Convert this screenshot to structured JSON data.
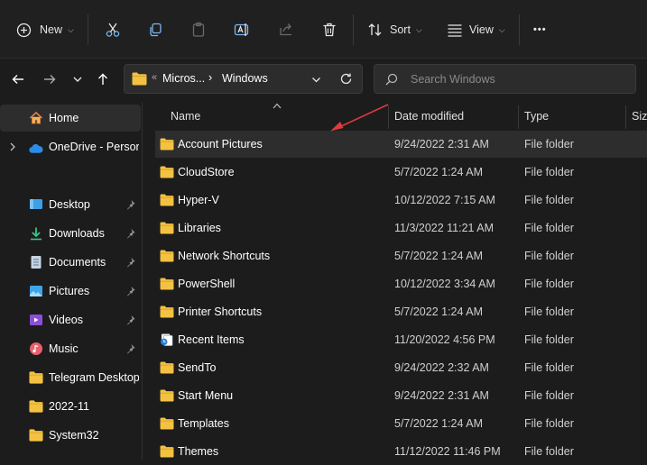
{
  "toolbar": {
    "new_label": "New",
    "sort_label": "Sort",
    "view_label": "View",
    "more_label": "•••"
  },
  "address": {
    "overflow": "«",
    "crumb1": "Micros...",
    "crumb_sep": "›",
    "crumb2": "Windows"
  },
  "search": {
    "placeholder": "Search Windows"
  },
  "nav": {
    "home": "Home",
    "onedrive": "OneDrive - Persona",
    "items": [
      {
        "label": "Desktop",
        "icon": "desktop-icon",
        "pinned": true
      },
      {
        "label": "Downloads",
        "icon": "downloads-icon",
        "pinned": true
      },
      {
        "label": "Documents",
        "icon": "documents-icon",
        "pinned": true
      },
      {
        "label": "Pictures",
        "icon": "pictures-icon",
        "pinned": true
      },
      {
        "label": "Videos",
        "icon": "videos-icon",
        "pinned": true
      },
      {
        "label": "Music",
        "icon": "music-icon",
        "pinned": true
      },
      {
        "label": "Telegram Desktop",
        "icon": "folder-icon",
        "pinned": false
      },
      {
        "label": "2022-11",
        "icon": "folder-icon",
        "pinned": false
      },
      {
        "label": "System32",
        "icon": "folder-icon",
        "pinned": false
      }
    ]
  },
  "columns": {
    "name": "Name",
    "date": "Date modified",
    "type": "Type",
    "size": "Size"
  },
  "files": [
    {
      "name": "Account Pictures",
      "date": "9/24/2022 2:31 AM",
      "type": "File folder",
      "icon": "folder-icon"
    },
    {
      "name": "CloudStore",
      "date": "5/7/2022 1:24 AM",
      "type": "File folder",
      "icon": "folder-icon"
    },
    {
      "name": "Hyper-V",
      "date": "10/12/2022 7:15 AM",
      "type": "File folder",
      "icon": "folder-icon"
    },
    {
      "name": "Libraries",
      "date": "11/3/2022 11:21 AM",
      "type": "File folder",
      "icon": "folder-icon"
    },
    {
      "name": "Network Shortcuts",
      "date": "5/7/2022 1:24 AM",
      "type": "File folder",
      "icon": "folder-icon"
    },
    {
      "name": "PowerShell",
      "date": "10/12/2022 3:34 AM",
      "type": "File folder",
      "icon": "folder-icon"
    },
    {
      "name": "Printer Shortcuts",
      "date": "5/7/2022 1:24 AM",
      "type": "File folder",
      "icon": "folder-icon"
    },
    {
      "name": "Recent Items",
      "date": "11/20/2022 4:56 PM",
      "type": "File folder",
      "icon": "recent-items-icon"
    },
    {
      "name": "SendTo",
      "date": "9/24/2022 2:32 AM",
      "type": "File folder",
      "icon": "folder-icon"
    },
    {
      "name": "Start Menu",
      "date": "9/24/2022 2:31 AM",
      "type": "File folder",
      "icon": "folder-icon"
    },
    {
      "name": "Templates",
      "date": "5/7/2022 1:24 AM",
      "type": "File folder",
      "icon": "folder-icon"
    },
    {
      "name": "Themes",
      "date": "11/12/2022 11:46 PM",
      "type": "File folder",
      "icon": "folder-icon"
    }
  ],
  "colors": {
    "background": "#1c1c1c",
    "toolbar": "#202020",
    "selected_row": "#2d2d2d",
    "folder": "#f4c242",
    "annotation_arrow": "#e0393e"
  }
}
